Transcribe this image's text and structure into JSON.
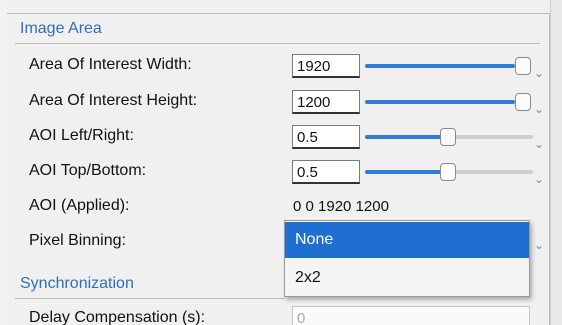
{
  "section_image_area": "Image Area",
  "section_sync": "Synchronization",
  "rows": [
    {
      "label": "Area Of Interest Width:",
      "value": "1920",
      "slider_fraction": 0.93
    },
    {
      "label": "Area Of Interest Height:",
      "value": "1200",
      "slider_fraction": 0.93
    },
    {
      "label": "AOI Left/Right:",
      "value": "0.5",
      "slider_fraction": 0.5
    },
    {
      "label": "AOI Top/Bottom:",
      "value": "0.5",
      "slider_fraction": 0.5
    }
  ],
  "applied": {
    "label": "AOI (Applied):",
    "value": "0 0 1920 1200"
  },
  "binning": {
    "label": "Pixel Binning:",
    "options": [
      "None",
      "2x2"
    ],
    "selected": "None"
  },
  "delay": {
    "label": "Delay Compensation (s):",
    "value": "0"
  },
  "colors": {
    "accent": "#2f7bd8",
    "section_title": "#2e6fbe",
    "selected_bg": "#1f6fd1"
  }
}
